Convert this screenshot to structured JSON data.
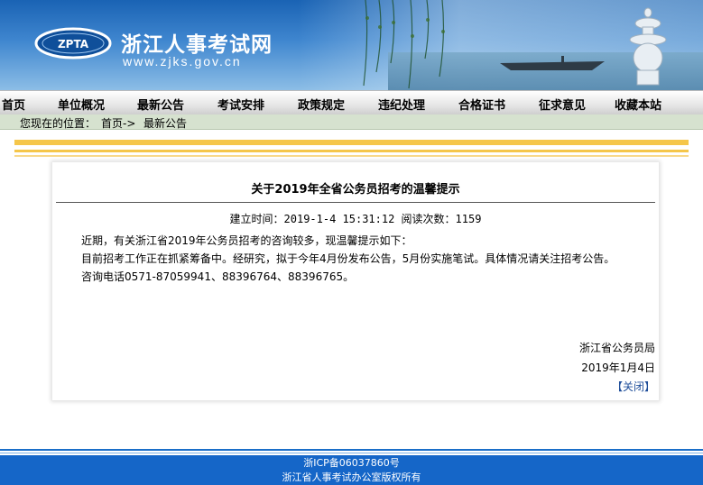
{
  "header": {
    "logo_text": "ZPTA",
    "site_title": "浙江人事考试网",
    "site_url": "www.zjks.gov.cn"
  },
  "nav": {
    "items": [
      "首页",
      "单位概况",
      "最新公告",
      "考试安排",
      "政策规定",
      "违纪处理",
      "合格证书",
      "征求意见",
      "收藏本站"
    ]
  },
  "breadcrumb": {
    "prefix": "您现在的位置：",
    "home": "首页->",
    "current": "最新公告"
  },
  "article": {
    "title": "关于2019年全省公务员招考的温馨提示",
    "meta": "建立时间：2019-1-4 15:31:12 阅读次数：1159",
    "paragraphs": [
      "近期，有关浙江省2019年公务员招考的咨询较多，现温馨提示如下：",
      "目前招考工作正在抓紧筹备中。经研究，拟于今年4月份发布公告，5月份实施笔试。具体情况请关注招考公告。",
      "咨询电话0571-87059941、88396764、88396765。"
    ],
    "signature_org": "浙江省公务员局",
    "signature_date": "2019年1月4日",
    "close_label": "【关闭】"
  },
  "footer": {
    "icp": "浙ICP备06037860号",
    "copyright": "浙江省人事考试办公室版权所有"
  },
  "colors": {
    "banner_blue": "#1a63b4",
    "stripe_yellow": "#f5c64a",
    "footer_blue": "#1566c8",
    "crumb_green": "#d6e2cf"
  }
}
